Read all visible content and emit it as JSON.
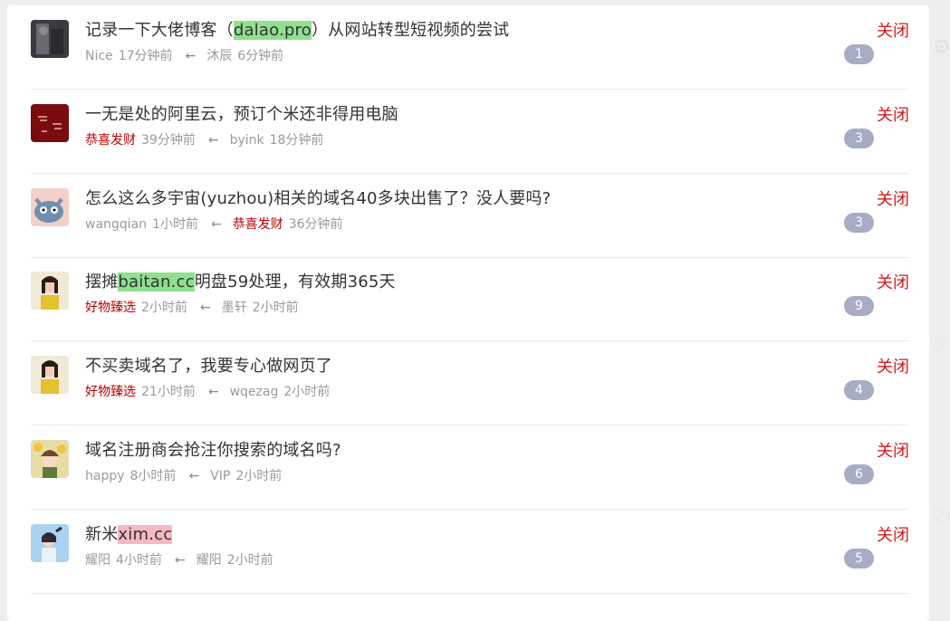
{
  "topics": [
    {
      "title_before": "记录一下大佬博客（",
      "title_hl": "dalao.pro",
      "title_after": "）从网站转型短视频的尝试",
      "hl_color": "green",
      "author": "Nice",
      "author_red": false,
      "time": "17分钟前",
      "last_user": "沐辰",
      "last_red": false,
      "last_time": "6分钟前",
      "replies": "1",
      "close_label": "关闭",
      "avatar_icon": "dark-photo-avatar"
    },
    {
      "title_before": "一无是处的阿里云，预订个米还非得用电脑",
      "title_hl": "",
      "title_after": "",
      "hl_color": "",
      "author": "恭喜发财",
      "author_red": true,
      "time": "39分钟前",
      "last_user": "byink",
      "last_red": false,
      "last_time": "18分钟前",
      "replies": "3",
      "close_label": "关闭",
      "avatar_icon": "red-calligraphy-avatar"
    },
    {
      "title_before": "怎么这么多宇宙(yuzhou)相关的域名40多块出售了？没人要吗?",
      "title_hl": "",
      "title_after": "",
      "hl_color": "",
      "author": "wangqian",
      "author_red": false,
      "time": "1小时前",
      "last_user": "恭喜发财",
      "last_red": true,
      "last_time": "36分钟前",
      "replies": "3",
      "close_label": "关闭",
      "avatar_icon": "cartoon-cat-avatar"
    },
    {
      "title_before": "摆摊",
      "title_hl": "baitan.cc",
      "title_after": "明盘59处理，有效期365天",
      "hl_color": "green",
      "author": "好物臻选",
      "author_red": true,
      "time": "2小时前",
      "last_user": "墨轩",
      "last_red": false,
      "last_time": "2小时前",
      "replies": "9",
      "close_label": "关闭",
      "avatar_icon": "girl-yellow-avatar"
    },
    {
      "title_before": "不买卖域名了，我要专心做网页了",
      "title_hl": "",
      "title_after": "",
      "hl_color": "",
      "author": "好物臻选",
      "author_red": true,
      "time": "21小时前",
      "last_user": "wqezag",
      "last_red": false,
      "last_time": "2小时前",
      "replies": "4",
      "close_label": "关闭",
      "avatar_icon": "girl-yellow-avatar"
    },
    {
      "title_before": "域名注册商会抢注你搜索的域名吗?",
      "title_hl": "",
      "title_after": "",
      "hl_color": "",
      "author": "happy",
      "author_red": false,
      "time": "8小时前",
      "last_user": "VIP",
      "last_red": false,
      "last_time": "2小时前",
      "replies": "6",
      "close_label": "关闭",
      "avatar_icon": "anime-girl-flowers-avatar"
    },
    {
      "title_before": "新米",
      "title_hl": "xim.cc",
      "title_after": "",
      "hl_color": "pink",
      "author": "耀阳",
      "author_red": false,
      "time": "4小时前",
      "last_user": "耀阳",
      "last_red": false,
      "last_time": "2小时前",
      "replies": "5",
      "close_label": "关闭",
      "avatar_icon": "girl-blue-avatar"
    }
  ],
  "arrow_glyph": "←",
  "colors": {
    "accent_red": "#d21a1a",
    "highlight_green": "#8fe08f",
    "highlight_pink": "#f7b8c2",
    "badge": "#a7acc4"
  }
}
